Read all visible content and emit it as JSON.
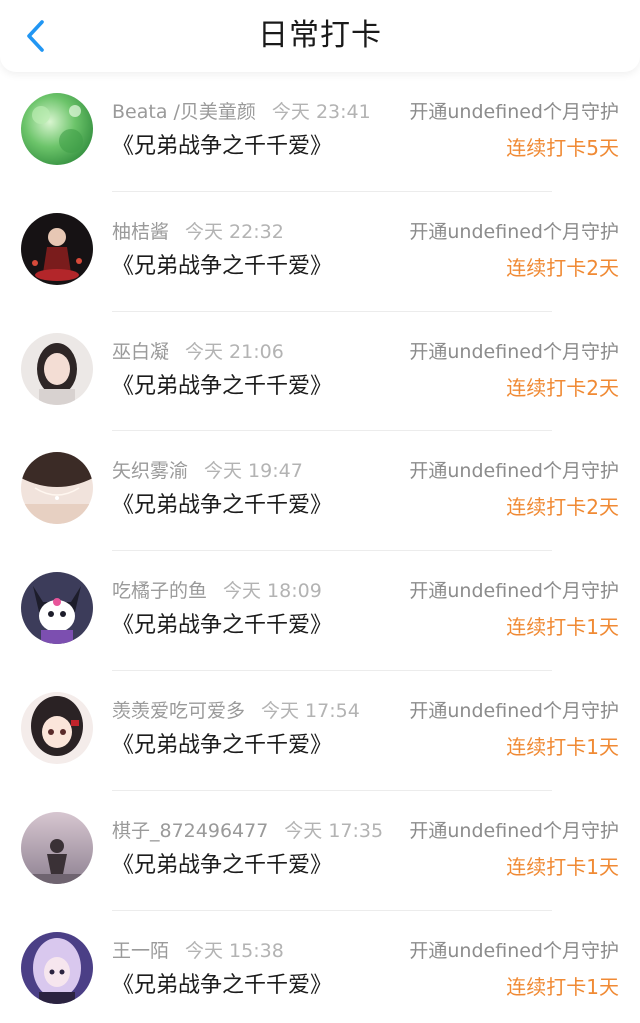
{
  "header": {
    "title": "日常打卡",
    "back_icon": "chevron-left-icon",
    "accent_color": "#2196f3"
  },
  "streak_color": "#f08a34",
  "entries": [
    {
      "user": "Beata /贝美童颜",
      "time": "今天 23:41",
      "guard": "开通undefined个月守护",
      "title": "《兄弟战争之千千爱》",
      "streak": "连续打卡5天"
    },
    {
      "user": "柚桔酱",
      "time": "今天 22:32",
      "guard": "开通undefined个月守护",
      "title": "《兄弟战争之千千爱》",
      "streak": "连续打卡2天"
    },
    {
      "user": "巫白凝",
      "time": "今天 21:06",
      "guard": "开通undefined个月守护",
      "title": "《兄弟战争之千千爱》",
      "streak": "连续打卡2天"
    },
    {
      "user": "矢织雾渝",
      "time": "今天 19:47",
      "guard": "开通undefined个月守护",
      "title": "《兄弟战争之千千爱》",
      "streak": "连续打卡2天"
    },
    {
      "user": "吃橘子的鱼",
      "time": "今天 18:09",
      "guard": "开通undefined个月守护",
      "title": "《兄弟战争之千千爱》",
      "streak": "连续打卡1天"
    },
    {
      "user": "羡羡爱吃可爱多",
      "time": "今天 17:54",
      "guard": "开通undefined个月守护",
      "title": "《兄弟战争之千千爱》",
      "streak": "连续打卡1天"
    },
    {
      "user": "棋子_872496477",
      "time": "今天 17:35",
      "guard": "开通undefined个月守护",
      "title": "《兄弟战争之千千爱》",
      "streak": "连续打卡1天"
    },
    {
      "user": "王一陌",
      "time": "今天 15:38",
      "guard": "开通undefined个月守护",
      "title": "《兄弟战争之千千爱》",
      "streak": "连续打卡1天"
    }
  ]
}
